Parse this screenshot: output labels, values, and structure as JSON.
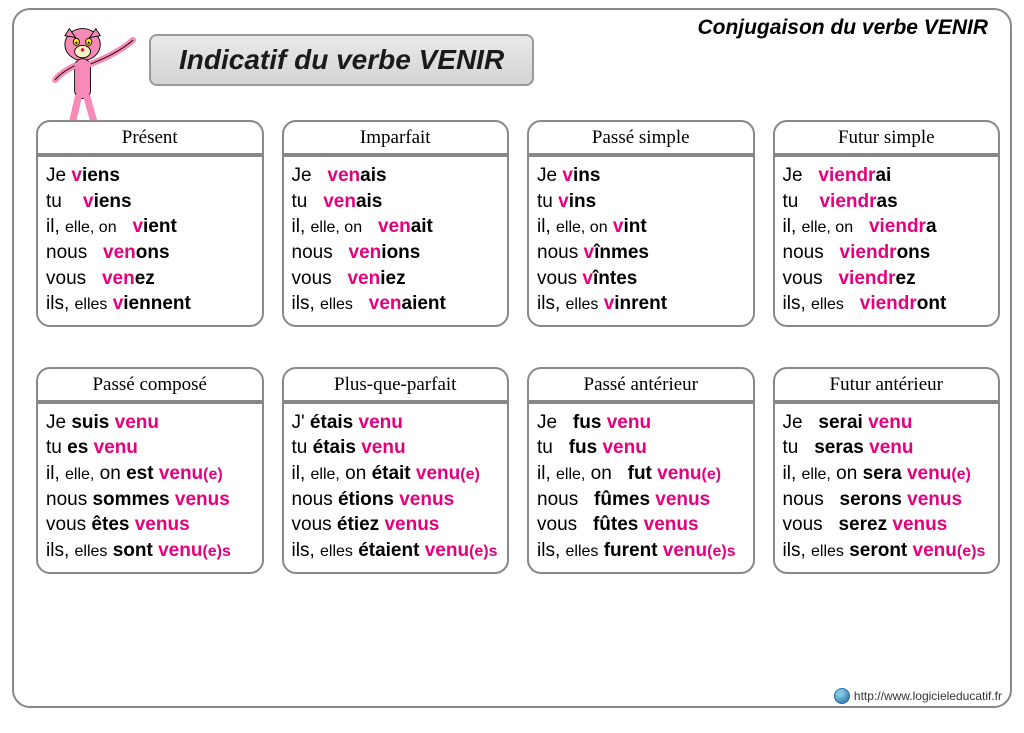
{
  "header": {
    "corner": "Conjugaison du verbe VENIR",
    "title": "Indicatif du verbe VENIR"
  },
  "footer": {
    "site": "http://www.logicieleducatif.fr"
  },
  "tenses": [
    {
      "name": "Présent",
      "lines": [
        {
          "p": "Je",
          "seg": [
            {
              "t": "v",
              "c": "pink"
            },
            {
              "t": "iens",
              "c": "blk"
            }
          ]
        },
        {
          "p": "tu",
          "pad": "   ",
          "seg": [
            {
              "t": "v",
              "c": "pink"
            },
            {
              "t": "iens",
              "c": "blk"
            }
          ]
        },
        {
          "p": "il, <span class='sm'>elle, on</span>",
          "pad": "  ",
          "seg": [
            {
              "t": "v",
              "c": "pink"
            },
            {
              "t": "ient",
              "c": "blk"
            }
          ]
        },
        {
          "p": "nous",
          "pad": "  ",
          "seg": [
            {
              "t": "ven",
              "c": "pink"
            },
            {
              "t": "ons",
              "c": "blk"
            }
          ]
        },
        {
          "p": "vous",
          "pad": "  ",
          "seg": [
            {
              "t": "ven",
              "c": "pink"
            },
            {
              "t": "ez",
              "c": "blk"
            }
          ]
        },
        {
          "p": "ils, <span class='sm'>elles</span>",
          "seg": [
            {
              "t": "v",
              "c": "pink"
            },
            {
              "t": "iennent",
              "c": "blk"
            }
          ]
        }
      ]
    },
    {
      "name": "Imparfait",
      "lines": [
        {
          "p": "Je",
          "pad": "  ",
          "seg": [
            {
              "t": "ven",
              "c": "pink"
            },
            {
              "t": "ais",
              "c": "blk"
            }
          ]
        },
        {
          "p": "tu",
          "pad": "  ",
          "seg": [
            {
              "t": "ven",
              "c": "pink"
            },
            {
              "t": "ais",
              "c": "blk"
            }
          ]
        },
        {
          "p": "il, <span class='sm'>elle, on</span>",
          "pad": "  ",
          "seg": [
            {
              "t": "ven",
              "c": "pink"
            },
            {
              "t": "ait",
              "c": "blk"
            }
          ]
        },
        {
          "p": "nous",
          "pad": "  ",
          "seg": [
            {
              "t": "ven",
              "c": "pink"
            },
            {
              "t": "ions",
              "c": "blk"
            }
          ]
        },
        {
          "p": "vous",
          "pad": "  ",
          "seg": [
            {
              "t": "ven",
              "c": "pink"
            },
            {
              "t": "iez",
              "c": "blk"
            }
          ]
        },
        {
          "p": "ils, <span class='sm'>elles</span>",
          "pad": "  ",
          "seg": [
            {
              "t": "ven",
              "c": "pink"
            },
            {
              "t": "aient",
              "c": "blk"
            }
          ]
        }
      ]
    },
    {
      "name": "Passé simple",
      "lines": [
        {
          "p": "Je",
          "seg": [
            {
              "t": "v",
              "c": "pink"
            },
            {
              "t": "ins",
              "c": "blk"
            }
          ]
        },
        {
          "p": "tu",
          "seg": [
            {
              "t": "v",
              "c": "pink"
            },
            {
              "t": "ins",
              "c": "blk"
            }
          ]
        },
        {
          "p": "il, <span class='sm'>elle, on</span>",
          "seg": [
            {
              "t": "v",
              "c": "pink"
            },
            {
              "t": "int",
              "c": "blk"
            }
          ]
        },
        {
          "p": "nous",
          "seg": [
            {
              "t": "v",
              "c": "pink"
            },
            {
              "t": "înmes",
              "c": "blk"
            }
          ]
        },
        {
          "p": "vous",
          "seg": [
            {
              "t": "v",
              "c": "pink"
            },
            {
              "t": "întes",
              "c": "blk"
            }
          ]
        },
        {
          "p": "ils, <span class='sm'>elles</span>",
          "seg": [
            {
              "t": "v",
              "c": "pink"
            },
            {
              "t": "inrent",
              "c": "blk"
            }
          ]
        }
      ]
    },
    {
      "name": "Futur simple",
      "lines": [
        {
          "p": "Je",
          "pad": "  ",
          "seg": [
            {
              "t": "viendr",
              "c": "pink"
            },
            {
              "t": "ai",
              "c": "blk"
            }
          ]
        },
        {
          "p": "tu",
          "pad": "   ",
          "seg": [
            {
              "t": "viendr",
              "c": "pink"
            },
            {
              "t": "as",
              "c": "blk"
            }
          ]
        },
        {
          "p": "il, <span class='sm'>elle, on</span>",
          "pad": "  ",
          "seg": [
            {
              "t": "viendr",
              "c": "pink"
            },
            {
              "t": "a",
              "c": "blk"
            }
          ]
        },
        {
          "p": "nous",
          "pad": "  ",
          "seg": [
            {
              "t": "viendr",
              "c": "pink"
            },
            {
              "t": "ons",
              "c": "blk"
            }
          ]
        },
        {
          "p": "vous",
          "pad": "  ",
          "seg": [
            {
              "t": "viendr",
              "c": "pink"
            },
            {
              "t": "ez",
              "c": "blk"
            }
          ]
        },
        {
          "p": "ils, <span class='sm'>elles</span>",
          "pad": "  ",
          "seg": [
            {
              "t": "viendr",
              "c": "pink"
            },
            {
              "t": "ont",
              "c": "blk"
            }
          ]
        }
      ]
    },
    {
      "name": "Passé composé",
      "lines": [
        {
          "p": "Je",
          "aux": "suis",
          "seg": [
            {
              "t": "venu",
              "c": "pink"
            }
          ]
        },
        {
          "p": "tu",
          "aux": "es",
          "seg": [
            {
              "t": "venu",
              "c": "pink"
            }
          ]
        },
        {
          "p": "il, <span class='sm'>elle,</span> on",
          "aux": "est",
          "seg": [
            {
              "t": "venu",
              "c": "pink"
            },
            {
              "t": "(e)",
              "c": "pink",
              "sm": true
            }
          ]
        },
        {
          "p": "nous",
          "aux": "sommes",
          "seg": [
            {
              "t": "venus",
              "c": "pink"
            }
          ]
        },
        {
          "p": "vous",
          "aux": "êtes",
          "seg": [
            {
              "t": "venus",
              "c": "pink"
            }
          ]
        },
        {
          "p": "ils, <span class='sm'>elles</span>",
          "aux": "sont",
          "seg": [
            {
              "t": "venu",
              "c": "pink"
            },
            {
              "t": "(e)s",
              "c": "pink",
              "sm": true
            }
          ]
        }
      ]
    },
    {
      "name": "Plus-que-parfait",
      "lines": [
        {
          "p": "J'",
          "aux": "étais",
          "seg": [
            {
              "t": "venu",
              "c": "pink"
            }
          ]
        },
        {
          "p": "tu",
          "aux": "étais",
          "seg": [
            {
              "t": "venu",
              "c": "pink"
            }
          ]
        },
        {
          "p": "il, <span class='sm'>elle,</span> on",
          "aux": "était",
          "seg": [
            {
              "t": "venu",
              "c": "pink"
            },
            {
              "t": "(e)",
              "c": "pink",
              "sm": true
            }
          ]
        },
        {
          "p": "nous",
          "aux": "étions",
          "seg": [
            {
              "t": "venus",
              "c": "pink"
            }
          ]
        },
        {
          "p": "vous",
          "aux": "étiez",
          "seg": [
            {
              "t": "venus",
              "c": "pink"
            }
          ]
        },
        {
          "p": "ils, <span class='sm'>elles</span>",
          "aux": "étaient",
          "seg": [
            {
              "t": "venu",
              "c": "pink"
            },
            {
              "t": "(e)s",
              "c": "pink",
              "sm": true
            }
          ]
        }
      ]
    },
    {
      "name": "Passé antérieur",
      "lines": [
        {
          "p": "Je",
          "pad": "  ",
          "aux": "fus",
          "seg": [
            {
              "t": "venu",
              "c": "pink"
            }
          ]
        },
        {
          "p": "tu",
          "pad": "  ",
          "aux": "fus",
          "seg": [
            {
              "t": "venu",
              "c": "pink"
            }
          ]
        },
        {
          "p": "il, <span class='sm'>elle,</span> on",
          "pad": "  ",
          "aux": "fut",
          "seg": [
            {
              "t": "venu",
              "c": "pink"
            },
            {
              "t": "(e)",
              "c": "pink",
              "sm": true
            }
          ]
        },
        {
          "p": "nous",
          "pad": "  ",
          "aux": "fûmes",
          "seg": [
            {
              "t": "venus",
              "c": "pink"
            }
          ]
        },
        {
          "p": "vous",
          "pad": "  ",
          "aux": "fûtes",
          "seg": [
            {
              "t": "venus",
              "c": "pink"
            }
          ]
        },
        {
          "p": "ils, <span class='sm'>elles</span>",
          "aux": "furent",
          "seg": [
            {
              "t": "venu",
              "c": "pink"
            },
            {
              "t": "(e)s",
              "c": "pink",
              "sm": true
            }
          ]
        }
      ]
    },
    {
      "name": "Futur antérieur",
      "lines": [
        {
          "p": "Je",
          "pad": "  ",
          "aux": "serai",
          "seg": [
            {
              "t": "venu",
              "c": "pink"
            }
          ]
        },
        {
          "p": "tu",
          "pad": "  ",
          "aux": "seras",
          "seg": [
            {
              "t": "venu",
              "c": "pink"
            }
          ]
        },
        {
          "p": "il, <span class='sm'>elle,</span> on",
          "aux": "sera",
          "seg": [
            {
              "t": "venu",
              "c": "pink"
            },
            {
              "t": "(e)",
              "c": "pink",
              "sm": true
            }
          ]
        },
        {
          "p": "nous",
          "pad": "  ",
          "aux": "serons",
          "seg": [
            {
              "t": "venus",
              "c": "pink"
            }
          ]
        },
        {
          "p": "vous",
          "pad": "  ",
          "aux": "serez",
          "seg": [
            {
              "t": "venus",
              "c": "pink"
            }
          ]
        },
        {
          "p": "ils, <span class='sm'>elles</span>",
          "aux": "seront",
          "seg": [
            {
              "t": "venu",
              "c": "pink"
            },
            {
              "t": "(e)s",
              "c": "pink",
              "sm": true
            }
          ]
        }
      ]
    }
  ]
}
